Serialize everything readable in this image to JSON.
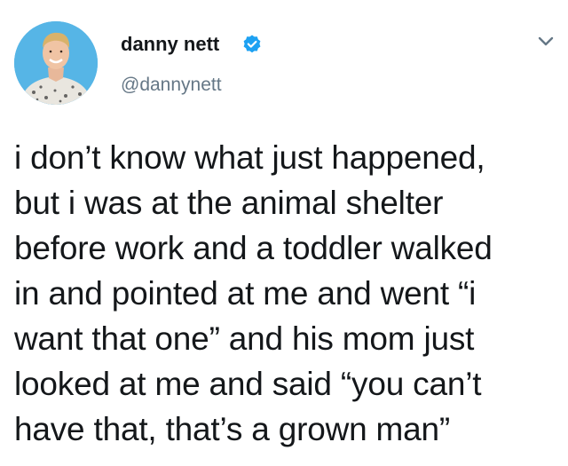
{
  "author": {
    "display_name": "danny nett",
    "handle": "@dannynett",
    "verified": true,
    "avatar_icon": "profile-photo-avatar"
  },
  "menu": {
    "icon": "chevron-down-icon"
  },
  "tweet": {
    "lines": [
      "i don’t know what just happened,",
      "but i was at the animal shelter",
      "before work and a toddler walked",
      "in and pointed at me and went “i",
      "want that one” and his mom just",
      "looked at me and said “you can’t",
      "have that, that’s a grown man”"
    ]
  },
  "colors": {
    "text": "#14171a",
    "handle": "#657786",
    "verified_badge": "#1da1f2",
    "avatar_background": "#56b5e6"
  }
}
